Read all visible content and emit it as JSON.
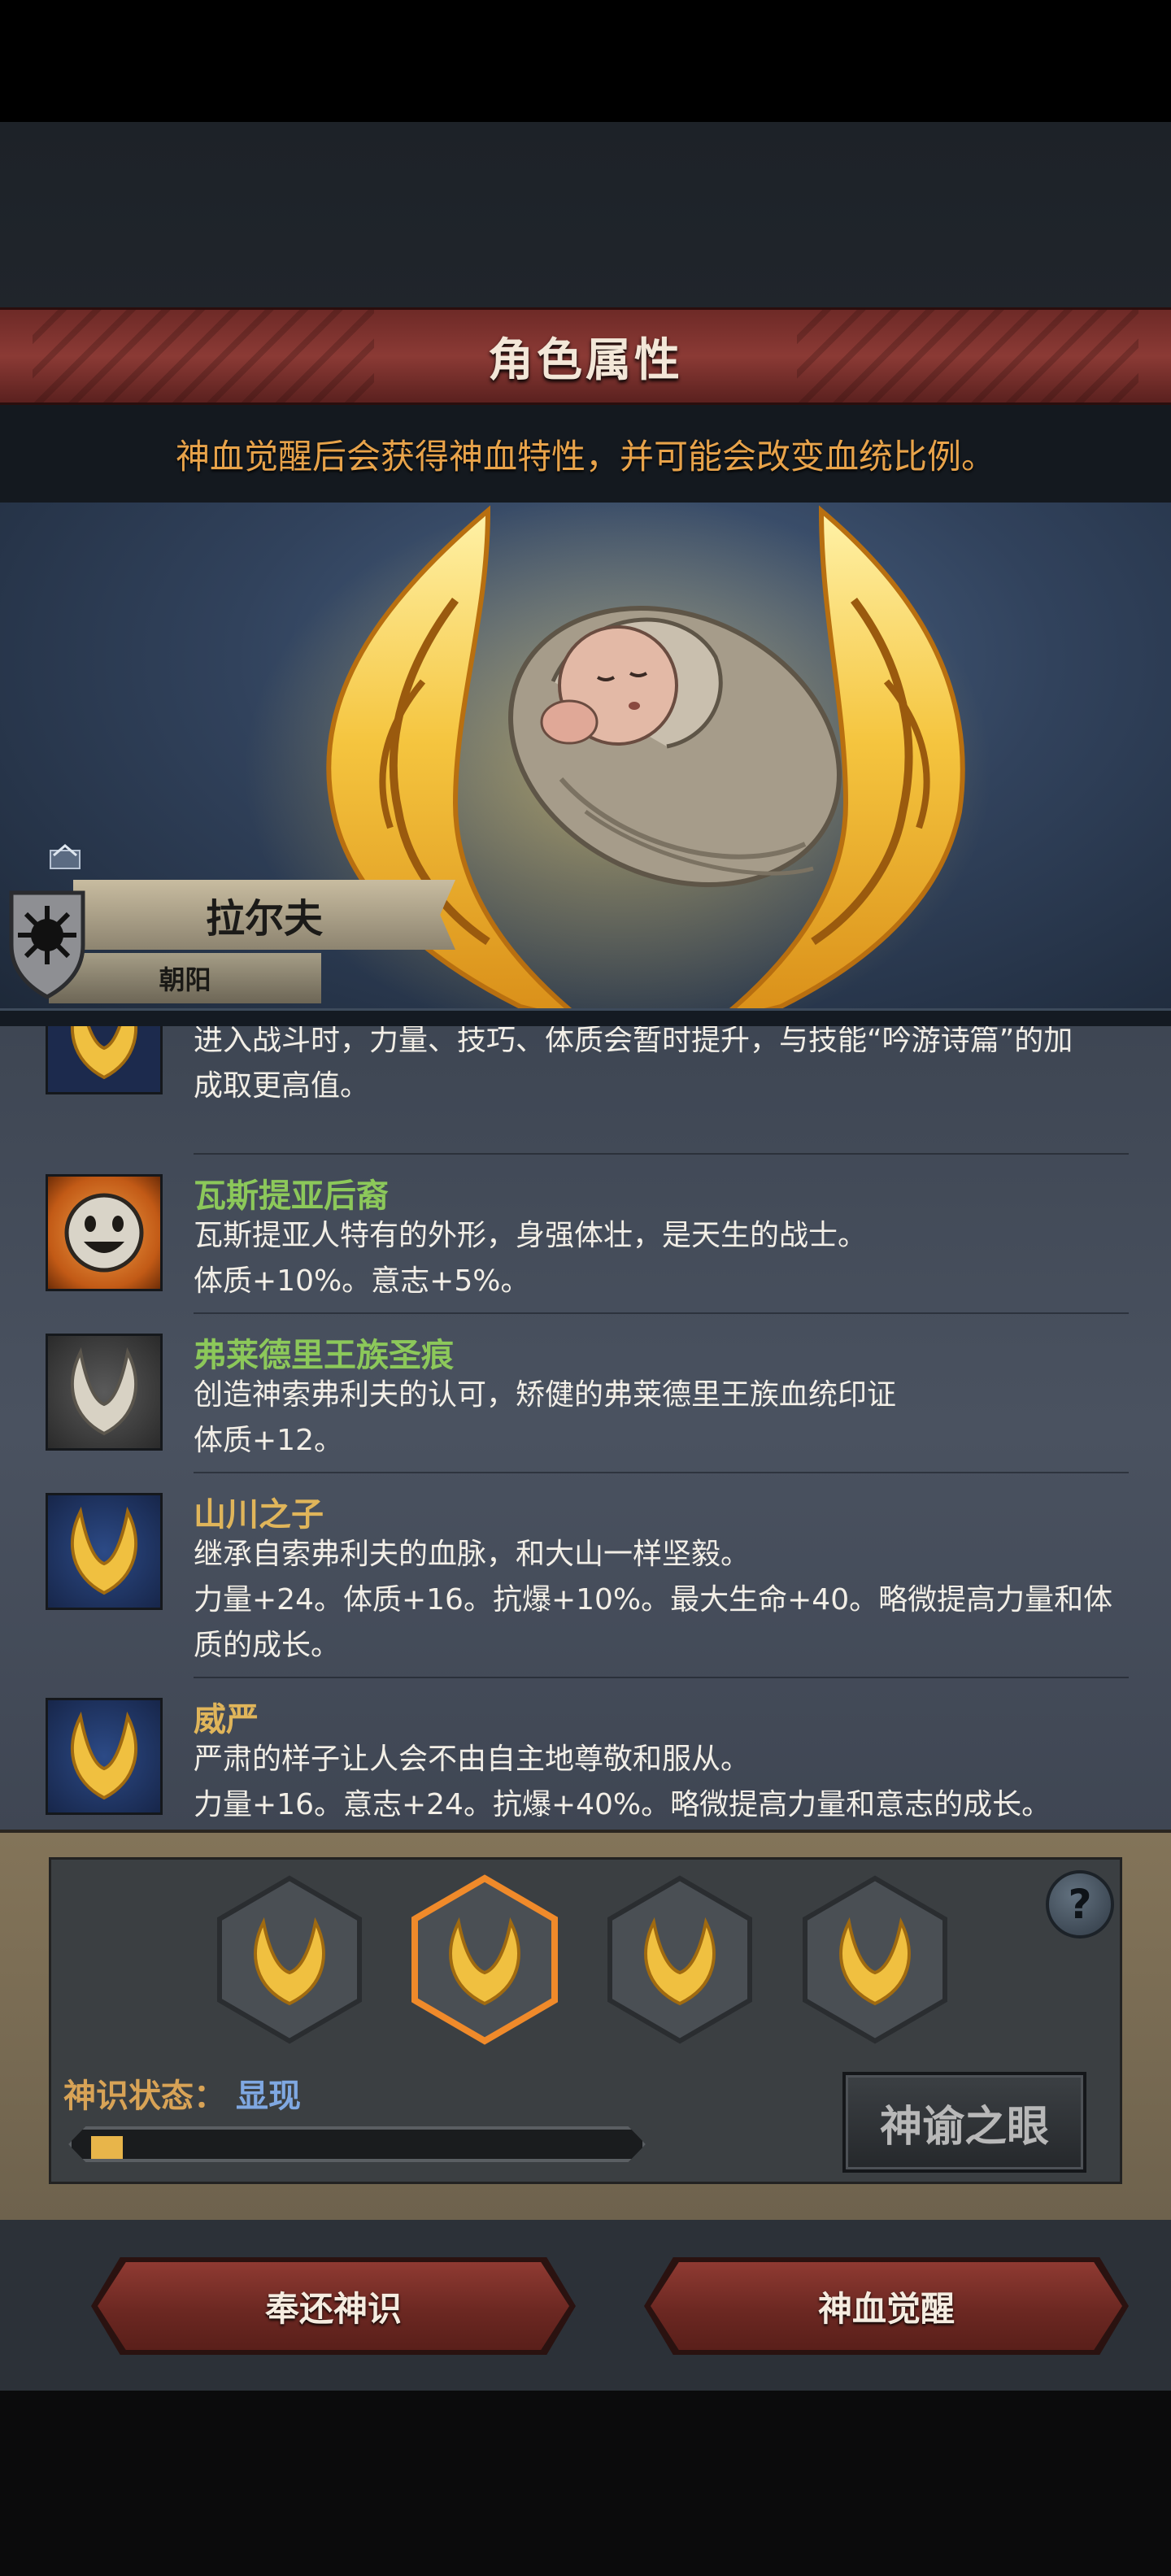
{
  "header": {
    "title": "角色属性",
    "subtitle": "神血觉醒后会获得神血特性，并可能会改变血统比例。"
  },
  "character": {
    "name": "拉尔夫",
    "epithet": "朝阳",
    "emblem_icon": "black-sun-shield-icon",
    "portrait": "swaddled-baby-portrait"
  },
  "traits": [
    {
      "name": "",
      "name_color": "#d8a356",
      "icon": "golden-wings-icon",
      "desc": "弗莱德里王族圣痕带来的强大力量。进入战斗时，力量、技巧、体质会暂时提升，与技能“吟游诗篇”的加成取更高值。",
      "desc_visible_lines": [
        "进入战斗时，力量、技巧、体质会暂时提升，与技能“吟游诗篇”的加",
        "成取更高值。"
      ]
    },
    {
      "name": "瓦斯提亚后裔",
      "name_color": "#8cc85a",
      "icon": "smiling-sun-face-icon",
      "desc_lines": [
        "瓦斯提亚人特有的外形，身强体壮，是天生的战士。",
        "体质+10%。意志+5%。"
      ]
    },
    {
      "name": "弗莱德里王族圣痕",
      "name_color": "#8cc85a",
      "icon": "silver-wings-icon",
      "desc_lines": [
        "创造神索弗利夫的认可，矫健的弗莱德里王族血统印证",
        "体质+12。"
      ]
    },
    {
      "name": "山川之子",
      "name_color": "#e0b55a",
      "icon": "golden-wings-icon",
      "desc_lines": [
        "继承自索弗利夫的血脉，和大山一样坚毅。",
        "力量+24。体质+16。抗爆+10%。最大生命+40。略微提高力量和体",
        "质的成长。"
      ]
    },
    {
      "name": "威严",
      "name_color": "#e0b55a",
      "icon": "golden-wings-icon",
      "desc_lines": [
        "严肃的样子让人会不由自主地尊敬和服从。",
        "力量+16。意志+24。抗爆+40%。略微提高力量和意志的成长。"
      ]
    }
  ],
  "controls": {
    "slots": [
      {
        "icon": "golden-wings-icon",
        "selected": false
      },
      {
        "icon": "golden-wings-icon",
        "selected": true
      },
      {
        "icon": "golden-wings-icon",
        "selected": false
      },
      {
        "icon": "golden-wings-icon",
        "selected": false
      }
    ],
    "help_label": "?",
    "status_label": "神识状态：",
    "status_value": "显现",
    "progress": 0.06,
    "oracle_button": "神谕之眼"
  },
  "actions": {
    "return_button": "奉还神识",
    "awaken_button": "神血觉醒"
  },
  "colors": {
    "accent_gold": "#e8b54a",
    "banner_red": "#8b3a35",
    "status_blue": "#7fa8e2"
  }
}
